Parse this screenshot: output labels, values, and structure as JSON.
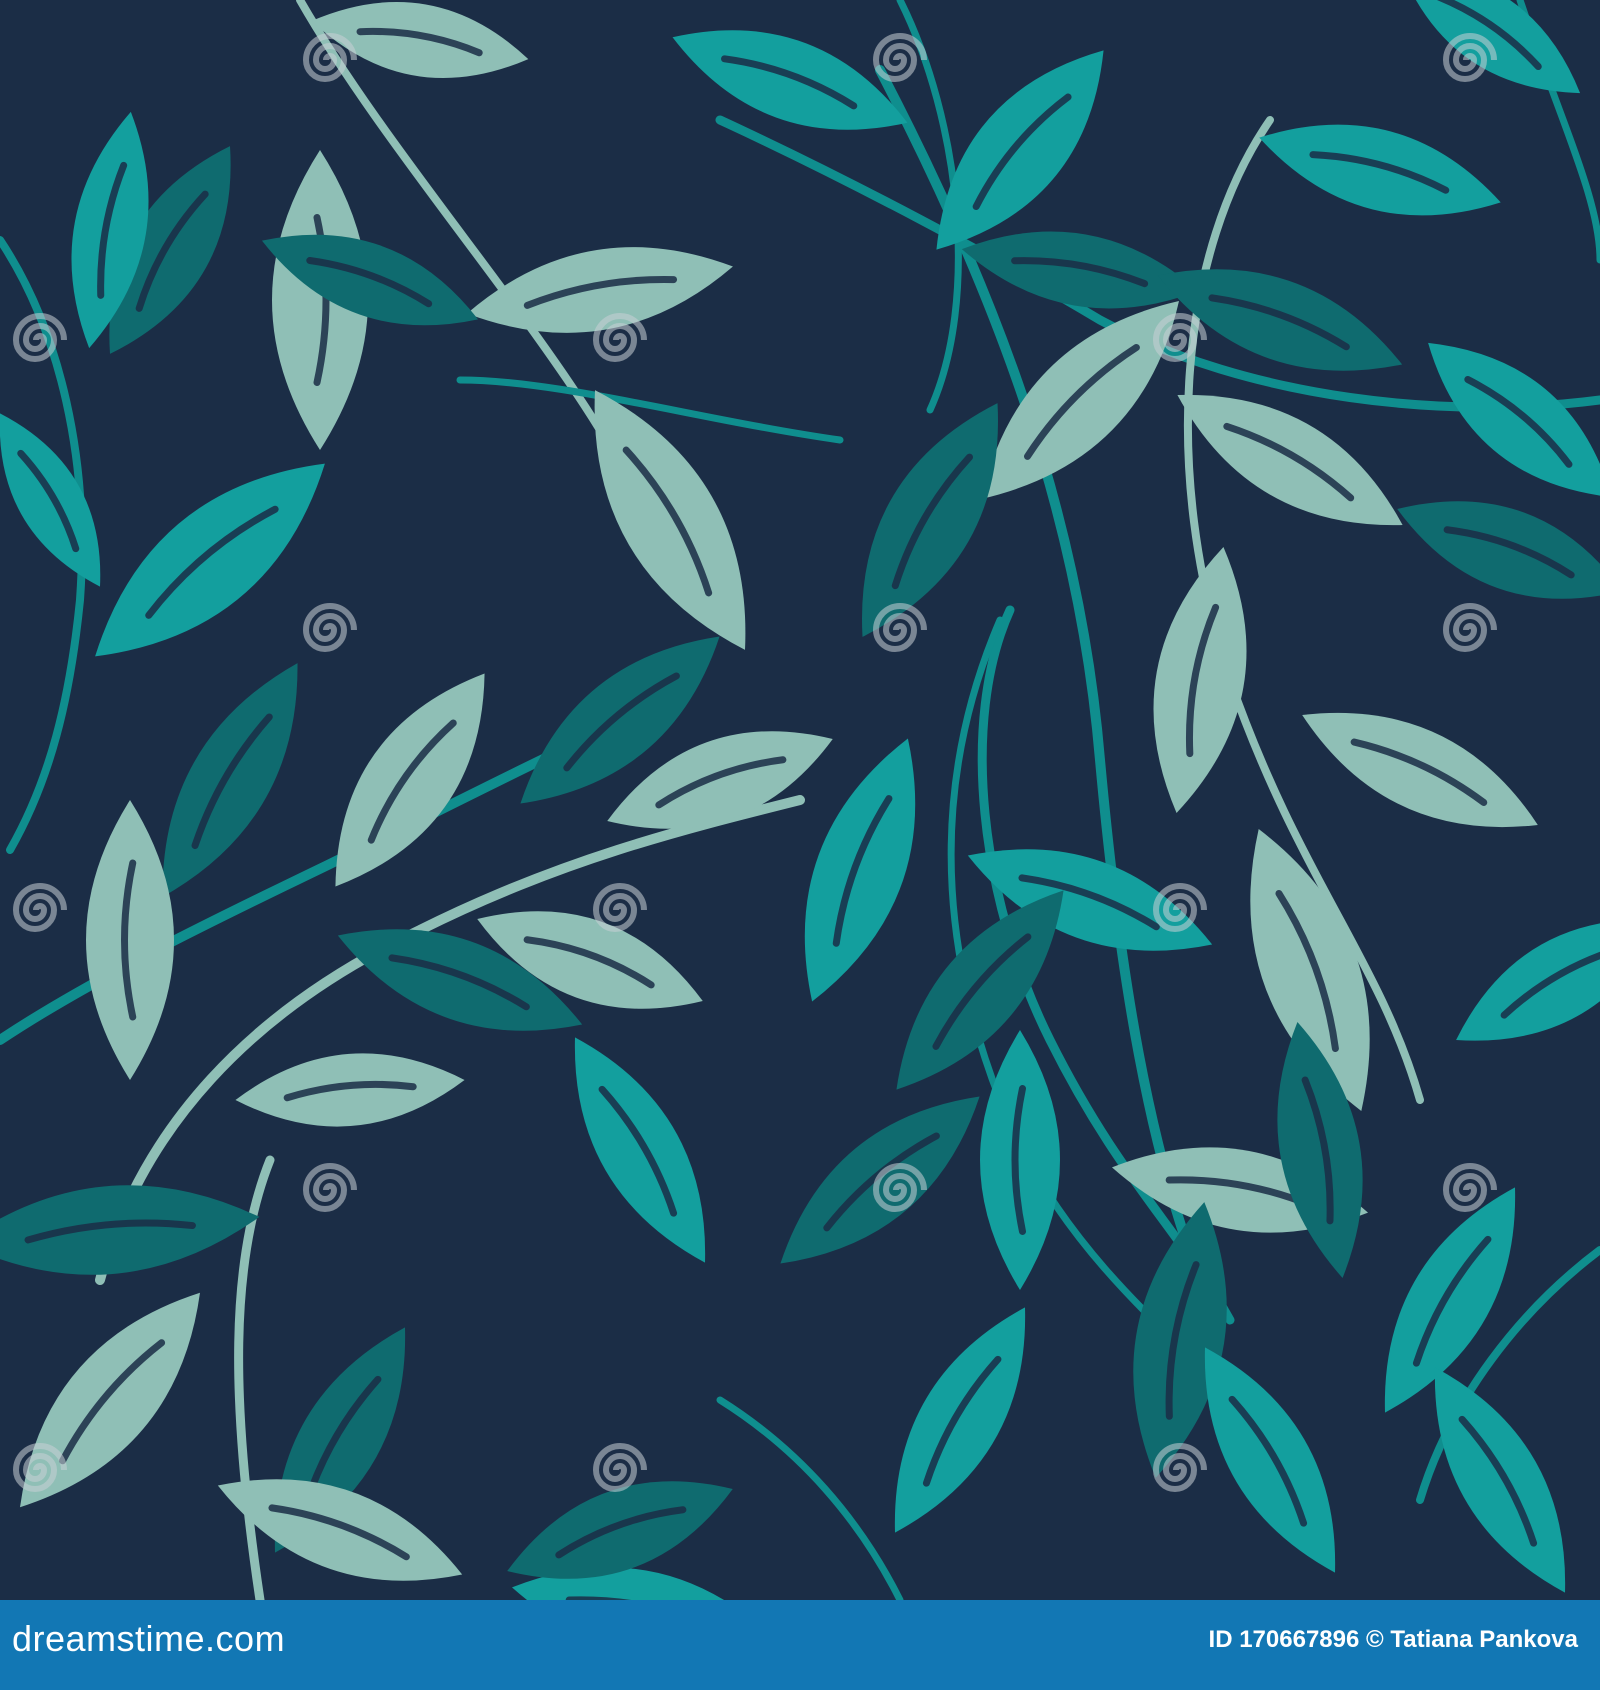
{
  "image": {
    "description_colors": {
      "background": "#1b2d46",
      "leaf_pale": "#8fbfb6",
      "leaf_teal": "#139f9e",
      "leaf_dark_teal": "#0f6b6f",
      "stem_pale": "#8fbfb6",
      "stem_teal": "#0f8e8e",
      "footer": "#1277b4"
    }
  },
  "watermark": {
    "text": "dreamstime",
    "icon": "spiral-icon"
  },
  "footer": {
    "logo_text": "dreamstime.com",
    "image_id": "ID 170667896",
    "copyright_symbol": "©",
    "author": "Tatiana Pankova"
  }
}
